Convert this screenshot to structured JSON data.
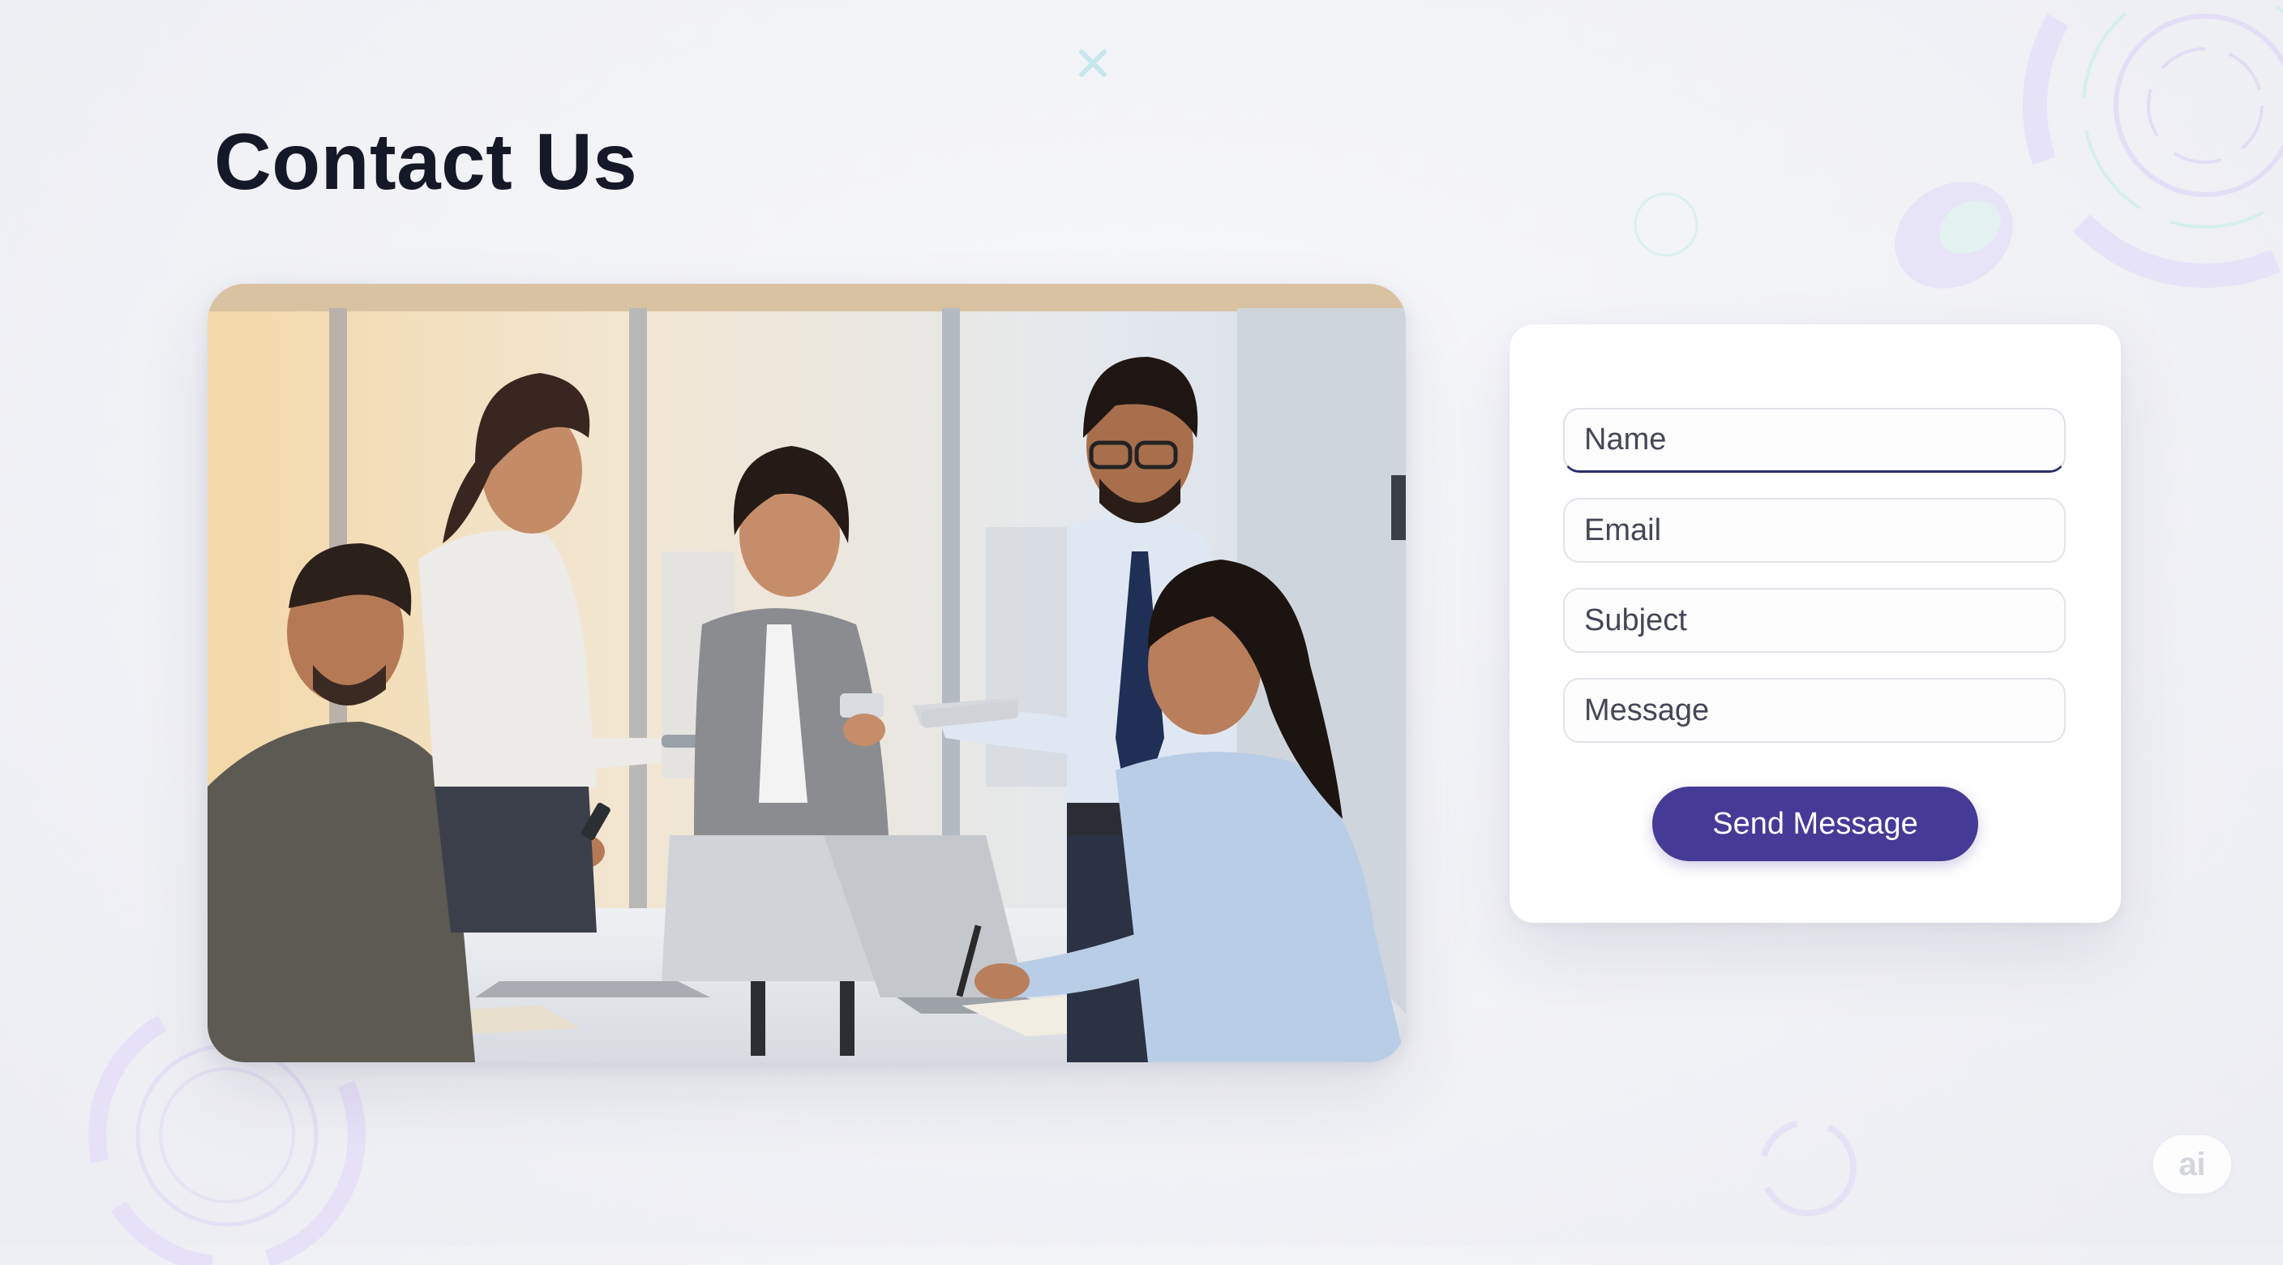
{
  "page": {
    "title": "Contact Us"
  },
  "hero_image": {
    "description_icon": "team-meeting-photo-icon"
  },
  "form": {
    "fields": [
      {
        "name": "name",
        "placeholder": "Name",
        "value": ""
      },
      {
        "name": "email",
        "placeholder": "Email",
        "value": ""
      },
      {
        "name": "subject",
        "placeholder": "Subject",
        "value": ""
      },
      {
        "name": "message",
        "placeholder": "Message",
        "value": ""
      }
    ],
    "submit_label": "Send Message"
  },
  "watermark": {
    "label": "ai"
  },
  "colors": {
    "accent": "#463a97",
    "active_field_border": "#2c2c6a",
    "heading": "#151827",
    "background": "#f1f2f6",
    "decor_lilac": "#ddd8f5",
    "decor_teal": "#c9eee9"
  }
}
